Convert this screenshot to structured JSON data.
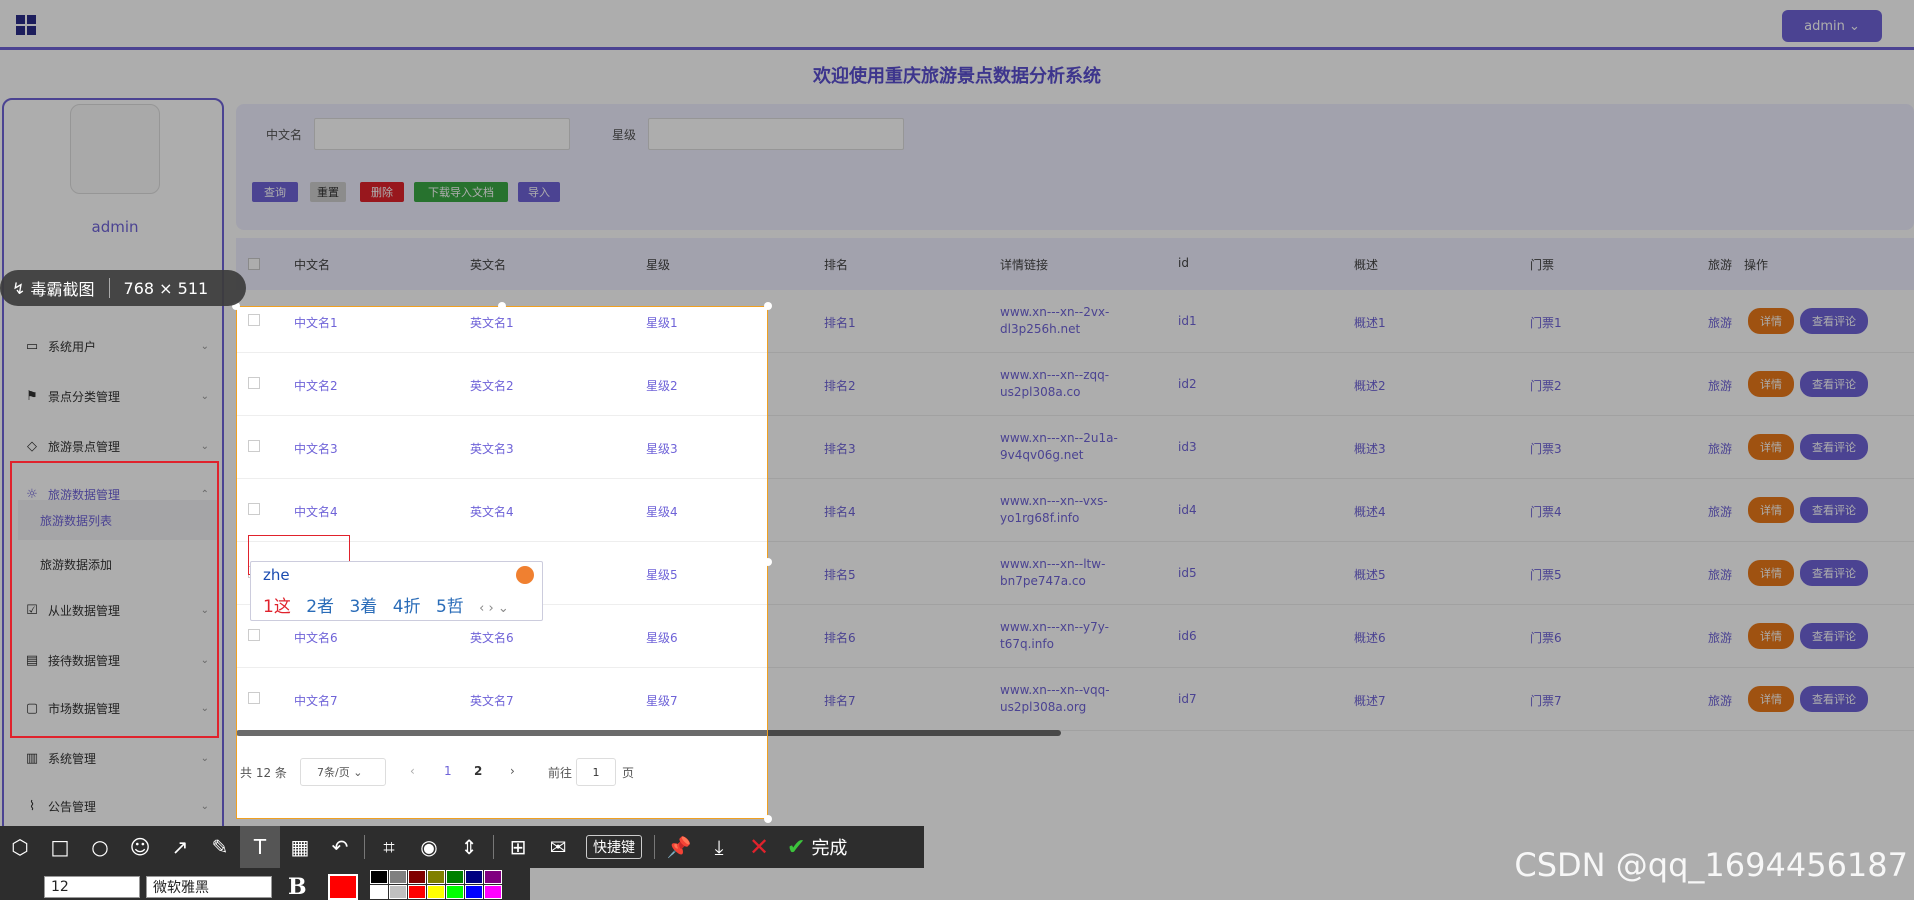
{
  "topbar": {
    "user_button": "admin ⌄"
  },
  "welcome": "欢迎使用重庆旅游景点数据分析系统",
  "sidebar": {
    "username": "admin",
    "items": [
      {
        "label": "系统用户"
      },
      {
        "label": "景点分类管理"
      },
      {
        "label": "旅游景点管理"
      },
      {
        "label": "旅游数据管理"
      },
      {
        "label": "从业数据管理"
      },
      {
        "label": "接待数据管理"
      },
      {
        "label": "市场数据管理"
      },
      {
        "label": "系统管理"
      },
      {
        "label": "公告管理"
      }
    ],
    "sub_items": [
      {
        "label": "旅游数据列表"
      },
      {
        "label": "旅游数据添加"
      }
    ]
  },
  "search": {
    "label_name": "中文名",
    "label_level": "星级",
    "btn_query": "查询",
    "btn_reset": "重置",
    "btn_delete": "删除",
    "btn_download": "下载导入文档",
    "btn_import": "导入",
    "colors": {
      "query": "#6f63d8",
      "reset": "#cfcfcf",
      "delete": "#e0222c",
      "download": "#3aa845",
      "import": "#6f63d8"
    }
  },
  "table": {
    "headers": [
      "中文名",
      "英文名",
      "星级",
      "排名",
      "详情链接",
      "id",
      "概述",
      "门票",
      "旅游",
      "操作"
    ],
    "rows": [
      {
        "name": "中文名1",
        "en": "英文名1",
        "level": "星级1",
        "rank": "排名1",
        "link": "www.xn---xn--2vx-dl3p256h.net",
        "id": "id1",
        "desc": "概述1",
        "ticket": "门票1",
        "extra": "旅游"
      },
      {
        "name": "中文名2",
        "en": "英文名2",
        "level": "星级2",
        "rank": "排名2",
        "link": "www.xn---xn--zqq-us2pl308a.co",
        "id": "id2",
        "desc": "概述2",
        "ticket": "门票2",
        "extra": "旅游"
      },
      {
        "name": "中文名3",
        "en": "英文名3",
        "level": "星级3",
        "rank": "排名3",
        "link": "www.xn---xn--2u1a-9v4qv06g.net",
        "id": "id3",
        "desc": "概述3",
        "ticket": "门票3",
        "extra": "旅游"
      },
      {
        "name": "中文名4",
        "en": "英文名4",
        "level": "星级4",
        "rank": "排名4",
        "link": "www.xn---xn--vxs-yo1rg68f.info",
        "id": "id4",
        "desc": "概述4",
        "ticket": "门票4",
        "extra": "旅游"
      },
      {
        "name": "",
        "en": "",
        "level": "星级5",
        "rank": "排名5",
        "link": "www.xn---xn--ltw-bn7pe747a.co",
        "id": "id5",
        "desc": "概述5",
        "ticket": "门票5",
        "extra": "旅游"
      },
      {
        "name": "中文名6",
        "en": "英文名6",
        "level": "星级6",
        "rank": "排名6",
        "link": "www.xn---xn--y7y-t67q.info",
        "id": "id6",
        "desc": "概述6",
        "ticket": "门票6",
        "extra": "旅游"
      },
      {
        "name": "中文名7",
        "en": "英文名7",
        "level": "星级7",
        "rank": "排名7",
        "link": "www.xn---xn--vqq-us2pl308a.org",
        "id": "id7",
        "desc": "概述7",
        "ticket": "门票7",
        "extra": "旅游"
      }
    ],
    "detail_label": "详情",
    "comment_label": "查看评论"
  },
  "pager": {
    "total": "共 12 条",
    "page_size": "7条/页 ⌄",
    "prev": "‹",
    "page1": "1",
    "page2": "2",
    "next": "›",
    "goto_prefix": "前往",
    "goto_value": "1",
    "goto_suffix": "页"
  },
  "capture_tool": {
    "name": "毒霸截图",
    "size": "768 × 511",
    "shortcut": "快捷键",
    "done": "完成",
    "font_size": "12",
    "font_name": "微软雅黑",
    "bold": "B",
    "current_color": "#ff0000",
    "palette": [
      "#000000",
      "#808080",
      "#800000",
      "#808000",
      "#008000",
      "#000080",
      "#800080",
      "#008080",
      "#ffffff",
      "#c0c0c0",
      "#ff0000",
      "#ffff00",
      "#00ff00",
      "#0000ff",
      "#ff00ff",
      "#00ffff"
    ]
  },
  "ime": {
    "pinyin": "zhe",
    "candidates": [
      "1这",
      "2者",
      "3着",
      "4折",
      "5哲"
    ]
  },
  "watermark": "CSDN @qq_1694456187"
}
